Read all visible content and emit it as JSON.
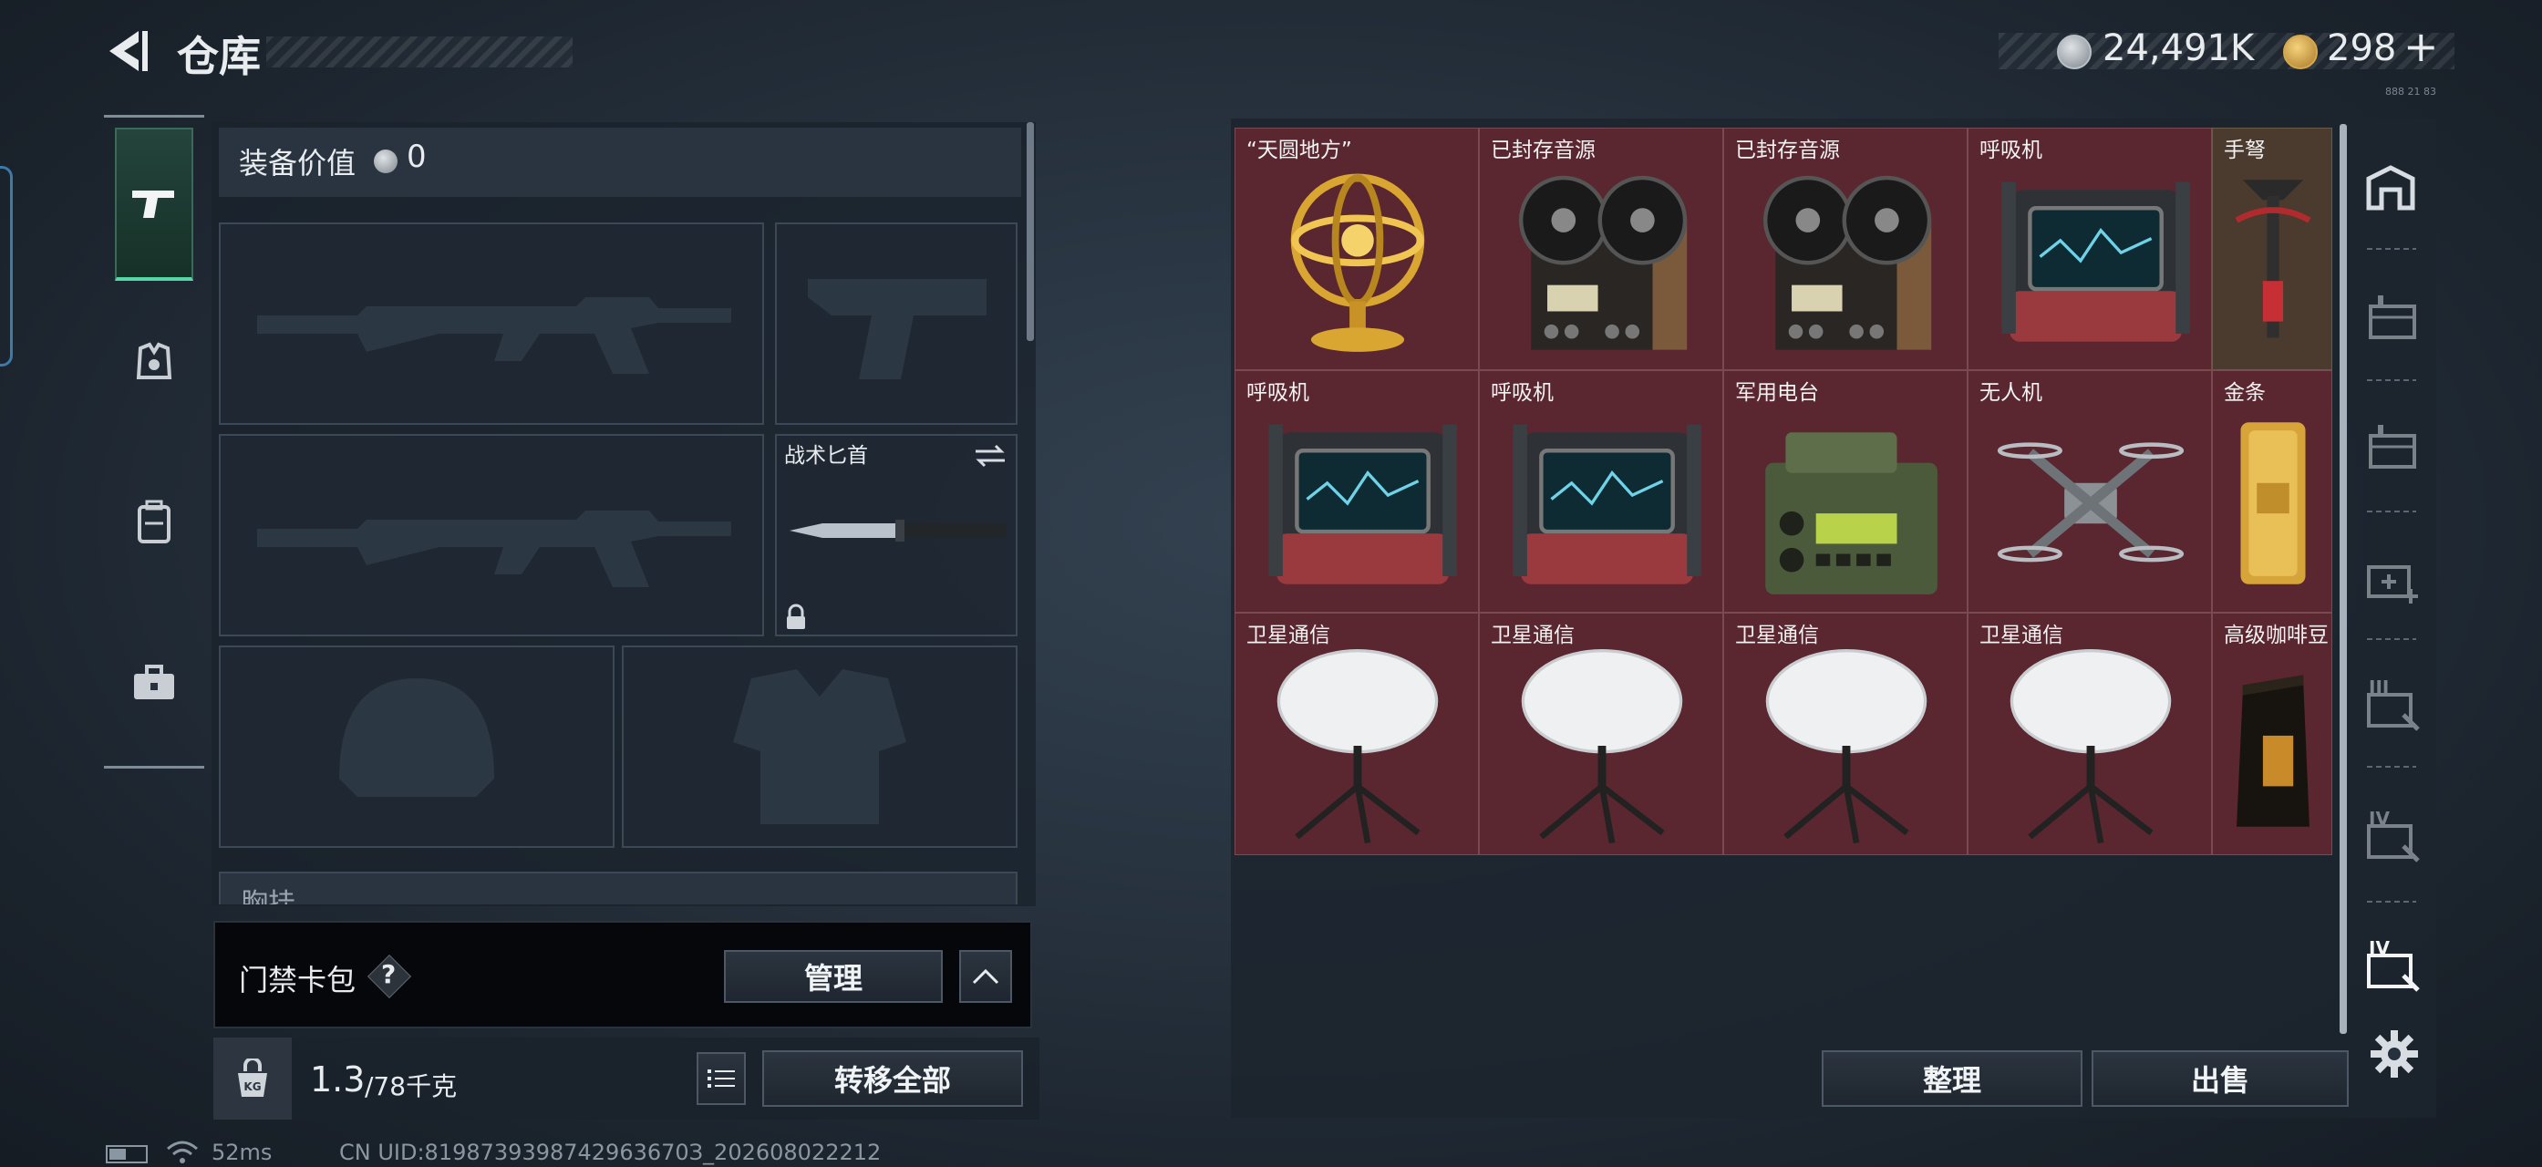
{
  "header": {
    "title": "仓库",
    "currency_primary": "24,491K",
    "currency_secondary": "298",
    "add_symbol": "+",
    "tiny_code": "888 21 83"
  },
  "loadout": {
    "equip_value_label": "装备价值",
    "equip_value": "0",
    "knife_label": "战术匕首",
    "chest_label": "胸挂"
  },
  "keycard": {
    "label": "门禁卡包",
    "help": "?",
    "manage_label": "管理"
  },
  "weight": {
    "unit_icon": "KG",
    "current": "1.3",
    "capacity": "/78千克",
    "transfer_all_label": "转移全部"
  },
  "stash": {
    "items": [
      {
        "label": "“天圆地方”",
        "icon": "armillary-sphere",
        "rarity": "red"
      },
      {
        "label": "已封存音源",
        "icon": "reel-to-reel-recorder",
        "rarity": "red"
      },
      {
        "label": "已封存音源",
        "icon": "reel-to-reel-recorder",
        "rarity": "red"
      },
      {
        "label": "呼吸机",
        "icon": "ventilator",
        "rarity": "red"
      },
      {
        "label": "手弩",
        "icon": "hand-crossbow",
        "rarity": "gold"
      },
      {
        "label": "呼吸机",
        "icon": "ventilator",
        "rarity": "red"
      },
      {
        "label": "呼吸机",
        "icon": "ventilator",
        "rarity": "red"
      },
      {
        "label": "军用电台",
        "icon": "military-radio",
        "rarity": "red"
      },
      {
        "label": "无人机",
        "icon": "drone",
        "rarity": "red"
      },
      {
        "label": "金条",
        "icon": "gold-bar",
        "rarity": "red"
      },
      {
        "label": "卫星通信",
        "icon": "satellite-dish",
        "rarity": "red"
      },
      {
        "label": "卫星通信",
        "icon": "satellite-dish",
        "rarity": "red"
      },
      {
        "label": "卫星通信",
        "icon": "satellite-dish",
        "rarity": "red"
      },
      {
        "label": "卫星通信",
        "icon": "satellite-dish",
        "rarity": "red"
      },
      {
        "label": "高级咖啡豆",
        "icon": "coffee-bag",
        "rarity": "red"
      }
    ],
    "sort_label": "整理",
    "sell_label": "出售",
    "tier_labels": [
      "III",
      "IV",
      "IV"
    ]
  },
  "status_bar": {
    "ping": "52ms",
    "uid": "CN UID:8198739398742963670З_202608022212"
  },
  "colors": {
    "accent_green": "#54d8a6",
    "cell_red": "#5a262f",
    "cell_gold": "#4a3b2e"
  }
}
